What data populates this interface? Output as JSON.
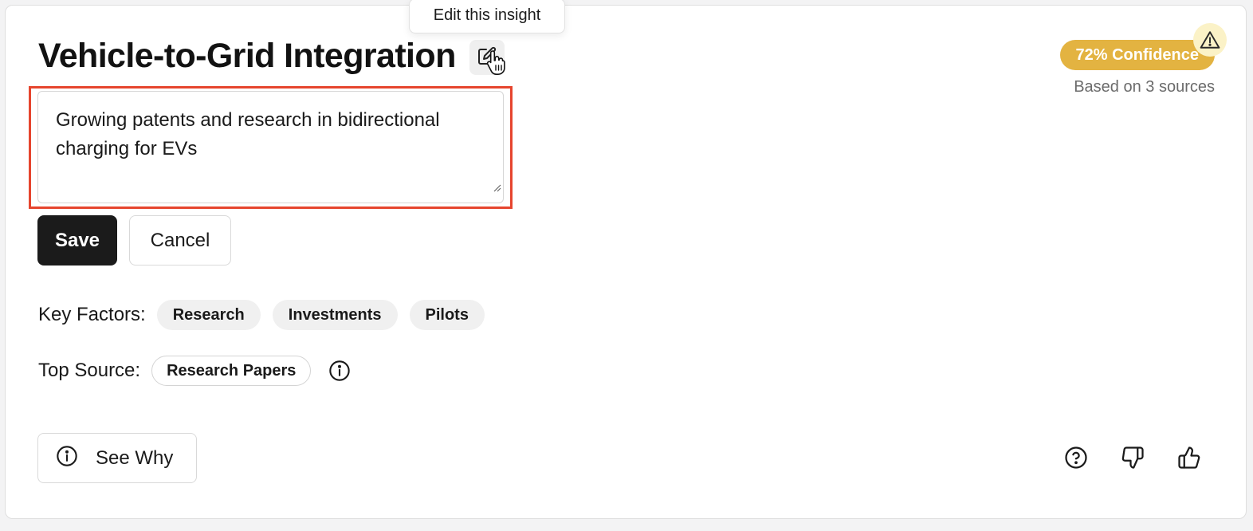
{
  "tooltip": {
    "text": "Edit this insight"
  },
  "insight": {
    "title": "Vehicle-to-Grid Integration",
    "description": "Growing patents and research in bidirectional charging for EVs"
  },
  "confidence": {
    "badge": "72% Confidence",
    "sources": "Based on 3 sources",
    "color": "#e3b341",
    "warning_icon": "warning-triangle-icon"
  },
  "actions": {
    "save_label": "Save",
    "cancel_label": "Cancel"
  },
  "key_factors": {
    "label": "Key Factors:",
    "items": [
      "Research",
      "Investments",
      "Pilots"
    ]
  },
  "top_source": {
    "label": "Top Source:",
    "value": "Research Papers"
  },
  "see_why": {
    "label": "See Why"
  },
  "feedback_icons": [
    "help-circle-icon",
    "thumbs-down-icon",
    "thumbs-up-icon"
  ],
  "colors": {
    "highlight": "#e6452e",
    "primary_button": "#1b1b1b"
  }
}
